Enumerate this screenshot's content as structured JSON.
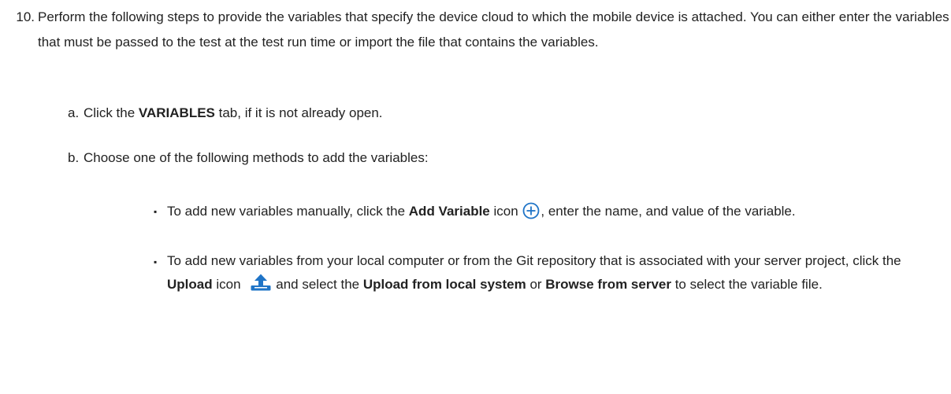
{
  "step10": {
    "number": "10.",
    "text": "Perform the following steps to provide the variables that specify the device cloud to which the mobile device is attached. You can either enter the variables that must be passed to the test at the test run time or import the file that contains the variables."
  },
  "step_a": {
    "letter": "a.",
    "pre": "Click the ",
    "bold": "VARIABLES",
    "post": " tab, if it is not already open."
  },
  "step_b": {
    "letter": "b.",
    "text": "Choose one of the following methods to add the variables:"
  },
  "bullets": {
    "marker": "▪",
    "first": {
      "pre": "To add new variables manually, click the ",
      "bold": "Add Variable",
      "mid": " icon ",
      "post": ", enter the name, and value of the variable.",
      "icon": "add-circle-icon"
    },
    "second": {
      "pre": "To add new variables from your local computer or from the Git repository that is associated with your server project, click the ",
      "bold1": "Upload",
      "mid1": " icon ",
      "mid2": "and select the ",
      "bold2": "Upload from local system",
      "mid3": " or ",
      "bold3": "Browse from server",
      "post": " to select the variable file.",
      "icon": "upload-icon"
    }
  },
  "colors": {
    "icon_blue": "#1f74c7",
    "text": "#222222"
  }
}
